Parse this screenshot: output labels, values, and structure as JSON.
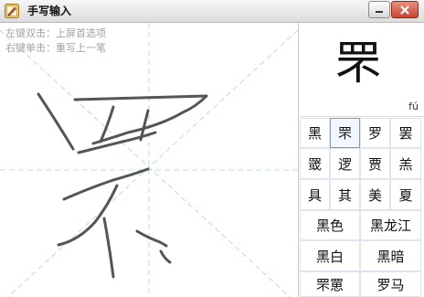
{
  "window": {
    "title": "手写输入",
    "minimize_label": "—",
    "close_label": "✕"
  },
  "hints": {
    "left_double_click": "左键双击：上屏首选项",
    "right_click": "右键单击：重写上一笔"
  },
  "preview": {
    "character": "罘",
    "pinyin": "fú"
  },
  "candidates": {
    "single": [
      "黑",
      "罘",
      "罗",
      "罢",
      "罭",
      "逻",
      "贾",
      "羔",
      "具",
      "其",
      "美",
      "夏"
    ],
    "selected_index": 1,
    "words": [
      "黑色",
      "黑龙江",
      "黑白",
      "黑暗",
      "罘罳",
      "罗马"
    ]
  },
  "colors": {
    "stroke": "#555555",
    "guide": "#b9dbe9",
    "close_button": "#c84630"
  }
}
